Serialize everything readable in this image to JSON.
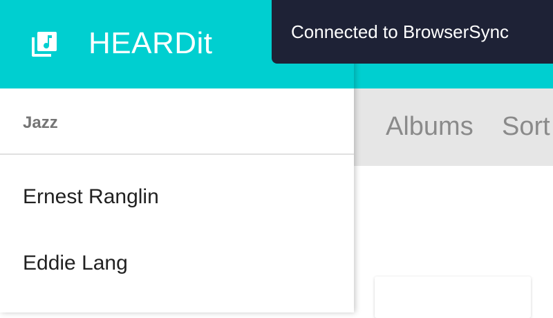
{
  "app": {
    "title": "HEARDit",
    "icon": "music-library-icon",
    "accent_color": "#00cfd0"
  },
  "drawer": {
    "section_title": "Jazz",
    "items": [
      {
        "label": "Ernest Ranglin"
      },
      {
        "label": "Eddie Lang"
      }
    ]
  },
  "toolbar": {
    "albums_label": "Albums",
    "sort_label": "Sort"
  },
  "toast": {
    "message": "Connected to BrowserSync",
    "background_color": "#1e2236"
  }
}
